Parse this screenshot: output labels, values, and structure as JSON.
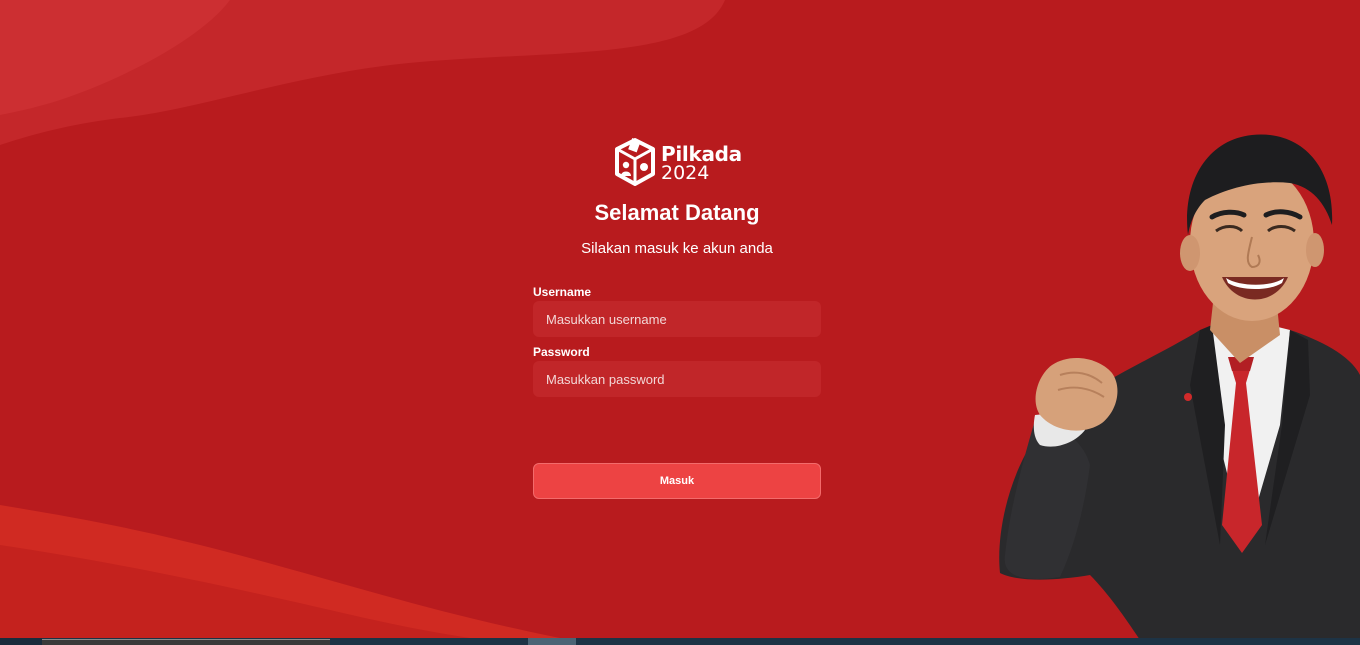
{
  "logo": {
    "word": "Pilkada",
    "year": "2024",
    "icon": "ballot-box-icon"
  },
  "header": {
    "title": "Selamat Datang",
    "subtitle": "Silakan masuk ke akun anda"
  },
  "form": {
    "username_label": "Username",
    "username_placeholder": "Masukkan username",
    "username_value": "",
    "password_label": "Password",
    "password_placeholder": "Masukkan password",
    "password_value": "",
    "submit_label": "Masuk"
  },
  "colors": {
    "background": "#b81b1e",
    "input_background": "#c12629",
    "button": "#ed4343",
    "text": "#ffffff"
  }
}
